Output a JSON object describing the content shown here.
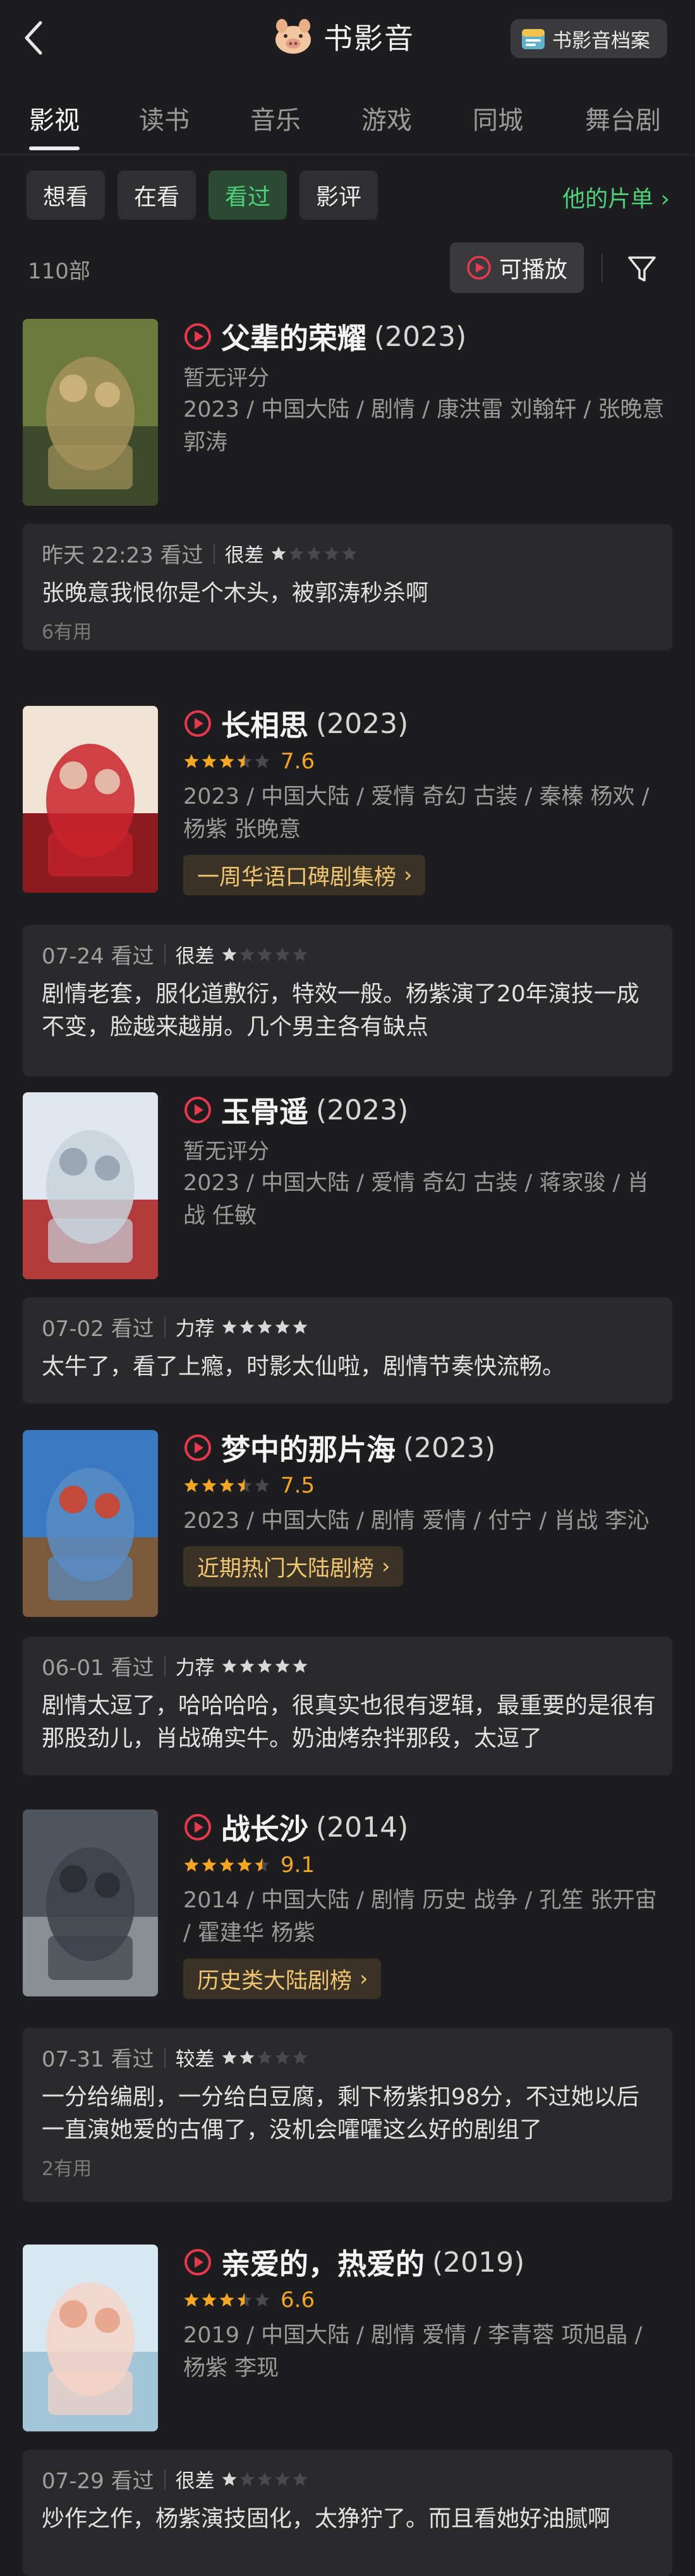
{
  "header": {
    "title": "书影音",
    "archive_label": "书影音档案"
  },
  "tabs": [
    "影视",
    "读书",
    "音乐",
    "游戏",
    "同城",
    "舞台剧"
  ],
  "chips": [
    "想看",
    "在看",
    "看过",
    "影评"
  ],
  "his_list": "他的片单",
  "count": "110部",
  "playable_label": "可播放",
  "colors": {
    "accent_green": "#4fd07a",
    "star_orange": "#f5a623",
    "badge_gold": "#f0c674",
    "play_red": "#e8384f"
  },
  "movies": [
    {
      "name": "父辈的荣耀",
      "year": "(2023)",
      "score": "",
      "rating_text": "暂无评分",
      "info": "2023 / 中国大陆 / 剧情 / 康洪雷 刘翰轩  / 张晚意 郭涛",
      "badge": "",
      "review": {
        "date": "昨天 22:23 看过",
        "level": "很差",
        "stars": 1,
        "text": "张晚意我恨你是个木头，被郭涛秒杀啊",
        "useful": "6有用"
      }
    },
    {
      "name": "长相思",
      "year": "(2023)",
      "score": "7.6",
      "score_value": 3.5,
      "rating_text": "",
      "info": "2023 / 中国大陆 / 爱情 奇幻 古装 / 秦榛 杨欢 / 杨紫 张晚意",
      "badge": "一周华语口碑剧集榜",
      "review": {
        "date": "07-24 看过",
        "level": "很差",
        "stars": 1,
        "text": "剧情老套，服化道敷衍，特效一般。杨紫演了20年演技一成不变，脸越来越崩。几个男主各有缺点",
        "useful": ""
      }
    },
    {
      "name": "玉骨遥",
      "year": "(2023)",
      "score": "",
      "rating_text": "暂无评分",
      "info": "2023 / 中国大陆 / 爱情 奇幻 古装 / 蒋家骏 / 肖战 任敏",
      "badge": "",
      "review": {
        "date": "07-02 看过",
        "level": "力荐",
        "stars": 5,
        "text": "太牛了，看了上瘾，时影太仙啦，剧情节奏快流畅。",
        "useful": ""
      }
    },
    {
      "name": "梦中的那片海",
      "year": "(2023)",
      "score": "7.5",
      "score_value": 3.5,
      "rating_text": "",
      "info": "2023 / 中国大陆 / 剧情 爱情 / 付宁 / 肖战 李沁",
      "badge": "近期热门大陆剧榜",
      "review": {
        "date": "06-01 看过",
        "level": "力荐",
        "stars": 5,
        "text": "剧情太逗了，哈哈哈哈，很真实也很有逻辑，最重要的是很有那股劲儿，肖战确实牛。奶油烤杂拌那段，太逗了",
        "useful": ""
      }
    },
    {
      "name": "战长沙",
      "year": "(2014)",
      "score": "9.1",
      "score_value": 4.5,
      "rating_text": "",
      "info": "2014 / 中国大陆 / 剧情 历史 战争 / 孔笙 张开宙 / 霍建华 杨紫",
      "badge": "历史类大陆剧榜",
      "review": {
        "date": "07-31 看过",
        "level": "较差",
        "stars": 2,
        "text": "一分给编剧，一分给白豆腐，剩下杨紫扣98分，不过她以后一直演她爱的古偶了，没机会嚯嚯这么好的剧组了",
        "useful": "2有用"
      }
    },
    {
      "name": "亲爱的，热爱的",
      "year": "(2019)",
      "score": "6.6",
      "score_value": 3.5,
      "rating_text": "",
      "info": "2019 / 中国大陆 / 剧情 爱情 / 李青蓉 项旭晶 / 杨紫 李现",
      "badge": "",
      "review": {
        "date": "07-29 看过",
        "level": "很差",
        "stars": 1,
        "text": "炒作之作，杨紫演技固化，太狰狞了。而且看她好油腻啊",
        "useful": ""
      }
    }
  ]
}
